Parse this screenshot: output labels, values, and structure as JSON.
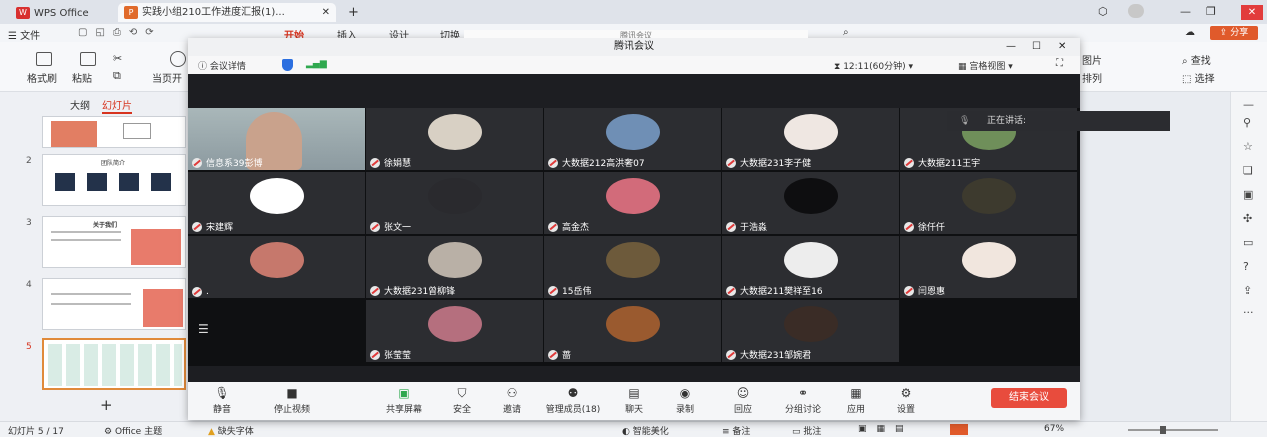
{
  "wps": {
    "home_tab": "WPS Office",
    "doc_tab": "实践小组210工作进度汇报(1)...",
    "new_tab": "+",
    "share_label": "分享",
    "menu": {
      "file": "文件",
      "home": "开始",
      "insert": "插入",
      "design": "设计",
      "transition": "切换"
    },
    "ribbon": {
      "format_painter": "格式刷",
      "paste": "粘贴",
      "from_current": "当页开",
      "pictures": "图片",
      "arrange": "排列",
      "find": "查找",
      "select": "选择"
    },
    "pane_tabs": {
      "outline": "大纲",
      "slides": "幻灯片"
    },
    "slides": [
      {
        "num": ""
      },
      {
        "num": "2",
        "title": "团队简介"
      },
      {
        "num": "3",
        "title": "关于我们"
      },
      {
        "num": "4",
        "title": ""
      },
      {
        "num": "5",
        "title": ""
      }
    ],
    "add_slide": "+",
    "status": {
      "slide_counter": "幻灯片 5 / 17",
      "theme": "Office 主题",
      "missing_font": "缺失字体",
      "smart_beautify": "智能美化",
      "notes": "备注",
      "comments": "批注",
      "zoom": "67%"
    }
  },
  "meeting": {
    "window_title": "腾讯会议",
    "behind_title": "腾讯会议",
    "details_label": "会议详情",
    "timer": "12:11(60分钟)",
    "view_label": "宫格视图",
    "speaking_label": "正在讲话:",
    "participants": [
      {
        "name": "信息系39彭博",
        "color": "#c9a28c",
        "video": true
      },
      {
        "name": "徐娟慧",
        "color": "#d8d0c4"
      },
      {
        "name": "大数据212高洪奢07",
        "color": "#6f8fb5"
      },
      {
        "name": "大数据231李子健",
        "color": "#efe7e2"
      },
      {
        "name": "大数据211王宇",
        "color": "#6f8f5a"
      },
      {
        "name": "宋建辉",
        "color": "#ffffff"
      },
      {
        "name": "张文一",
        "color": "#2a2a2e"
      },
      {
        "name": "高金杰",
        "color": "#d26b7a"
      },
      {
        "name": "于浩淼",
        "color": "#0e0e10"
      },
      {
        "name": "徐仟仟",
        "color": "#3d3a2e"
      },
      {
        "name": ".",
        "color": "#c6786c"
      },
      {
        "name": "大数据231曾柳锋",
        "color": "#b9b0a6"
      },
      {
        "name": "15岳伟",
        "color": "#6d5a3b"
      },
      {
        "name": "大数据211樊祥至16",
        "color": "#ededed"
      },
      {
        "name": "闫恩惠",
        "color": "#f1e6de"
      },
      {
        "name": "",
        "color": ""
      },
      {
        "name": "张莹莹",
        "color": "#b56f7e"
      },
      {
        "name": "蔷",
        "color": "#9a5a2f"
      },
      {
        "name": "大数据231邹婉君",
        "color": "#3a2c26"
      }
    ],
    "toolbar": {
      "mute": "静音",
      "stop_video": "停止视频",
      "share_screen": "共享屏幕",
      "security": "安全",
      "invite": "邀请",
      "manage_members": "管理成员(18)",
      "chat": "聊天",
      "record": "录制",
      "reactions": "回应",
      "breakout": "分组讨论",
      "apps": "应用",
      "settings": "设置",
      "end_meeting": "结束会议"
    }
  }
}
